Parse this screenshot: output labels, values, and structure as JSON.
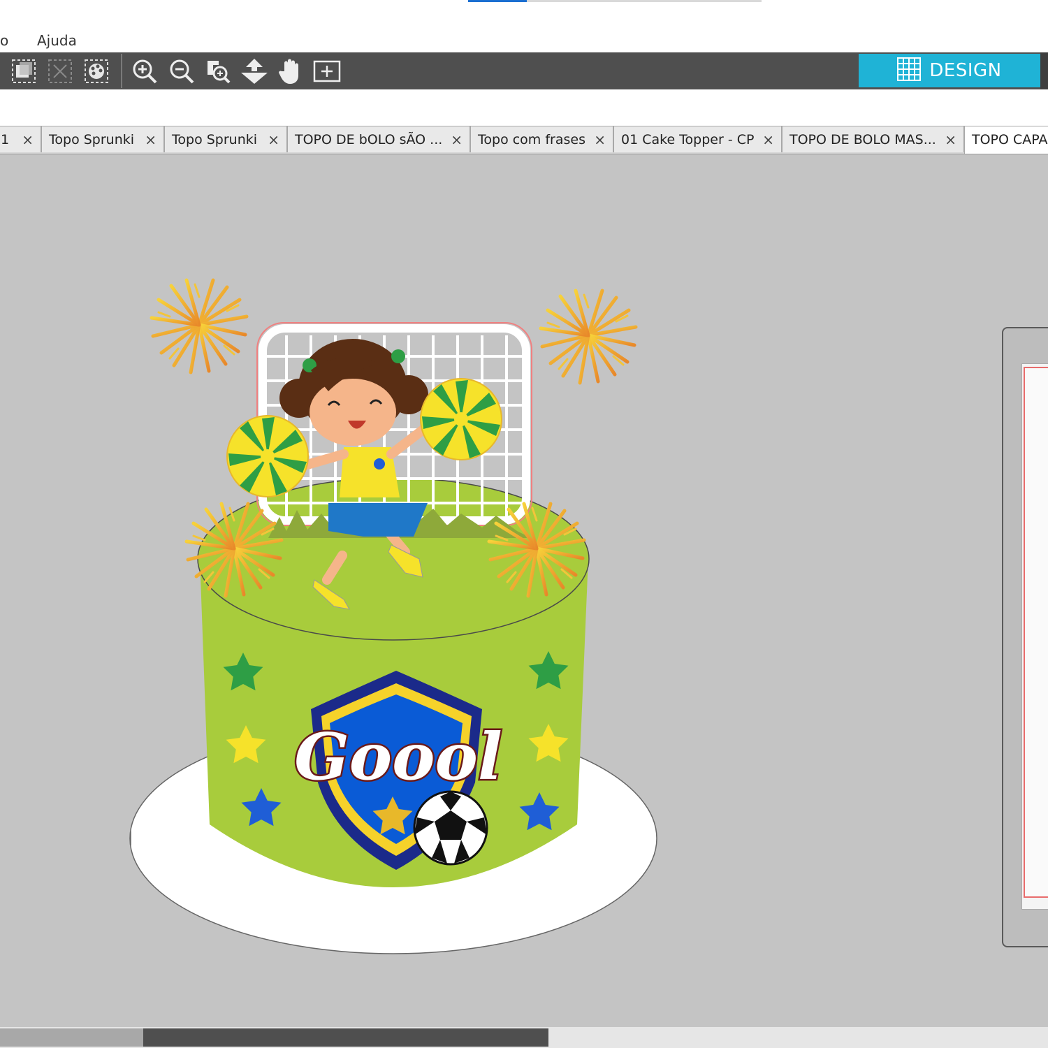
{
  "menubar": {
    "items": [
      {
        "label": "o"
      },
      {
        "label": "Ajuda"
      }
    ]
  },
  "toolbar": {
    "tools": [
      {
        "icon": "group-select-icon"
      },
      {
        "icon": "deselect-icon"
      },
      {
        "icon": "select-by-color-icon"
      },
      {
        "icon": "zoom-in-icon"
      },
      {
        "icon": "zoom-out-icon"
      },
      {
        "icon": "zoom-selection-icon"
      },
      {
        "icon": "pan-down-arrow-icon"
      },
      {
        "icon": "hand-pan-icon"
      },
      {
        "icon": "fit-to-page-icon"
      }
    ],
    "design_label": "DESIGN",
    "accent": "#1fb3d6"
  },
  "tabs": [
    {
      "label": "1",
      "active": false
    },
    {
      "label": "Topo Sprunki",
      "active": false
    },
    {
      "label": "Topo Sprunki",
      "active": false
    },
    {
      "label": "TOPO DE bOLO sÃO ...",
      "active": false
    },
    {
      "label": "Topo com frases",
      "active": false
    },
    {
      "label": "01 Cake Topper - CP",
      "active": false
    },
    {
      "label": "TOPO DE BOLO MAS...",
      "active": false
    },
    {
      "label": "TOPO CAPA",
      "active": true
    }
  ],
  "tab_close_glyph": "×",
  "canvas": {
    "artwork": {
      "type": "cake-topper-design",
      "text": "Goool",
      "colors": {
        "cake_green": "#a8cc3c",
        "board_white": "#ffffff",
        "shield_blue": "#0a5bd6",
        "star_green": "#2e9e45",
        "star_yellow": "#f6e22a",
        "star_blue": "#1f5ed6",
        "firework_gold": "#f2b02a"
      }
    }
  }
}
